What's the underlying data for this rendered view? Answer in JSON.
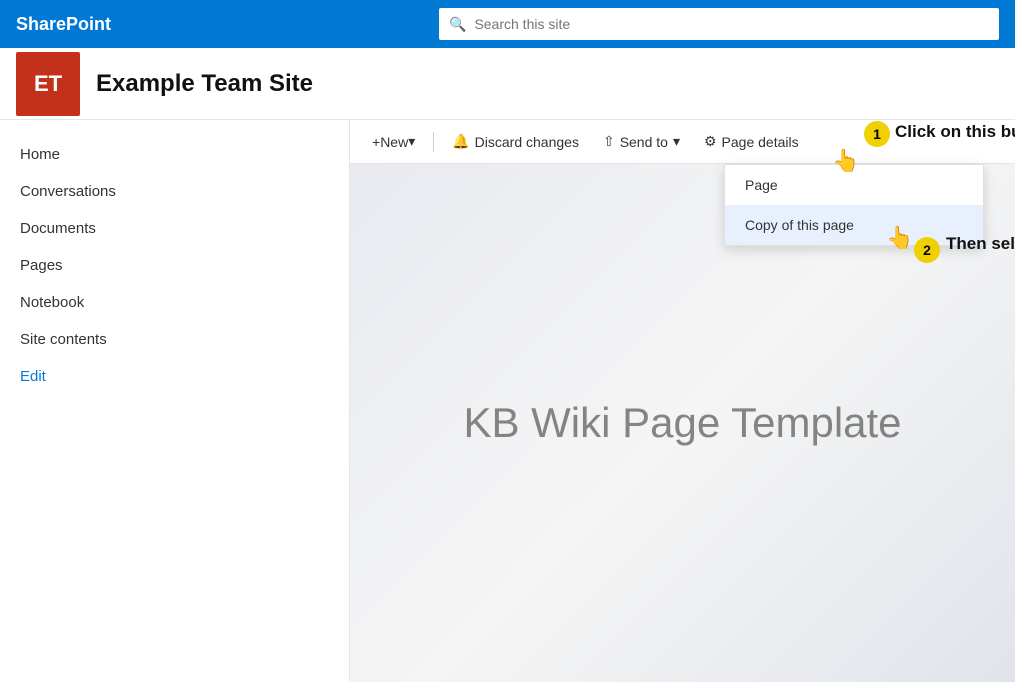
{
  "topbar": {
    "brand": "SharePoint",
    "search_placeholder": "Search this site"
  },
  "site": {
    "initials": "ET",
    "title": "Example Team Site"
  },
  "sidebar": {
    "items": [
      {
        "label": "Home",
        "id": "home",
        "active": false
      },
      {
        "label": "Conversations",
        "id": "conversations",
        "active": false
      },
      {
        "label": "Documents",
        "id": "documents",
        "active": false
      },
      {
        "label": "Pages",
        "id": "pages",
        "active": false
      },
      {
        "label": "Notebook",
        "id": "notebook",
        "active": false
      },
      {
        "label": "Site contents",
        "id": "site-contents",
        "active": false
      },
      {
        "label": "Edit",
        "id": "edit",
        "active": false,
        "special": "blue"
      }
    ]
  },
  "toolbar": {
    "new_label": "New",
    "new_chevron": "▾",
    "discard_changes_label": "Discard changes",
    "send_to_label": "Send to",
    "send_to_chevron": "▾",
    "page_details_label": "Page details",
    "plus_icon": "+",
    "share_icon": "⇧",
    "gear_icon": "⚙"
  },
  "dropdown": {
    "items": [
      {
        "label": "Page",
        "id": "page"
      },
      {
        "label": "Copy of this page",
        "id": "copy-of-this-page"
      }
    ]
  },
  "page_content": {
    "title": "KB Wiki Page Template"
  },
  "annotations": {
    "badge1": "1",
    "text1": "Click on this button first",
    "badge2": "2",
    "text2": "Then select this option"
  }
}
